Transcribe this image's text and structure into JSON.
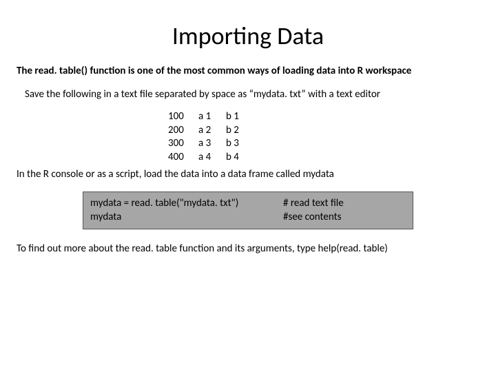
{
  "title": "Importing Data",
  "intro": "The read. table() function is one of the most common ways of loading data into R workspace",
  "save_line": "Save the following in a text file separated by space as “mydata. txt” with a text editor",
  "data_rows": [
    {
      "c1": "100",
      "c2": "a 1",
      "c3": "b 1"
    },
    {
      "c1": "200",
      "c2": "a 2",
      "c3": "b 2"
    },
    {
      "c1": "300",
      "c2": "a 3",
      "c3": "b 3"
    },
    {
      "c1": "400",
      "c2": "a 4",
      "c3": "b 4"
    }
  ],
  "load_line": "In the R console or as a script, load the data into a data frame called mydata",
  "code": {
    "line1_cmd": "mydata = read. table(\"mydata. txt\")",
    "line1_comment": "# read text file",
    "line2_cmd": "mydata",
    "line2_comment": "#see contents"
  },
  "help_line": "To find out more about the read. table function and its arguments, type help(read. table)"
}
